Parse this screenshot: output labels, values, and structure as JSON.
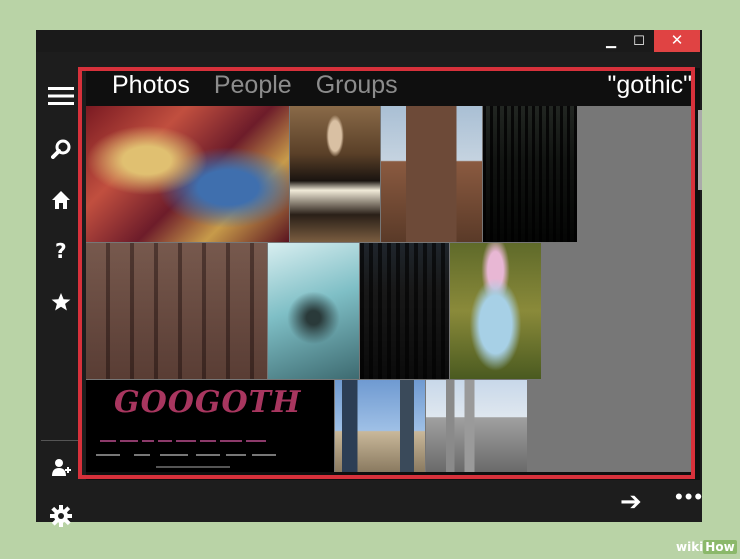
{
  "window": {
    "minimize_glyph": "▁",
    "maximize_glyph": "☐",
    "close_glyph": "✕"
  },
  "sidebar": {
    "icons": [
      "menu-icon",
      "search-icon",
      "home-icon",
      "help-icon",
      "star-icon",
      "add-user-icon",
      "gear-icon"
    ]
  },
  "tabs": [
    {
      "label": "Photos",
      "active": true
    },
    {
      "label": "People",
      "active": false
    },
    {
      "label": "Groups",
      "active": false
    }
  ],
  "search_query": "\"gothic\"",
  "results": {
    "googoth_logo": "GOOGOTH",
    "photo_subjects": [
      "ornate-ceiling-photo",
      "gothic-lolita-portrait-photo",
      "stone-tower-photo",
      "dark-cathedral-photo",
      "stone-arches-photo",
      "bare-tree-photo",
      "cathedral-facade-photo",
      "victorian-dress-photo",
      "googoth-search-screenshot",
      "skyscrapers-photo",
      "cathedral-spires-photo"
    ]
  },
  "bottom": {
    "next_glyph": "➔",
    "more_glyph": "•••"
  },
  "watermark": {
    "prefix": "wiki",
    "suffix": "How"
  },
  "colors": {
    "highlight": "#d7313b",
    "close": "#e04343",
    "background": "#b9d3a6"
  }
}
